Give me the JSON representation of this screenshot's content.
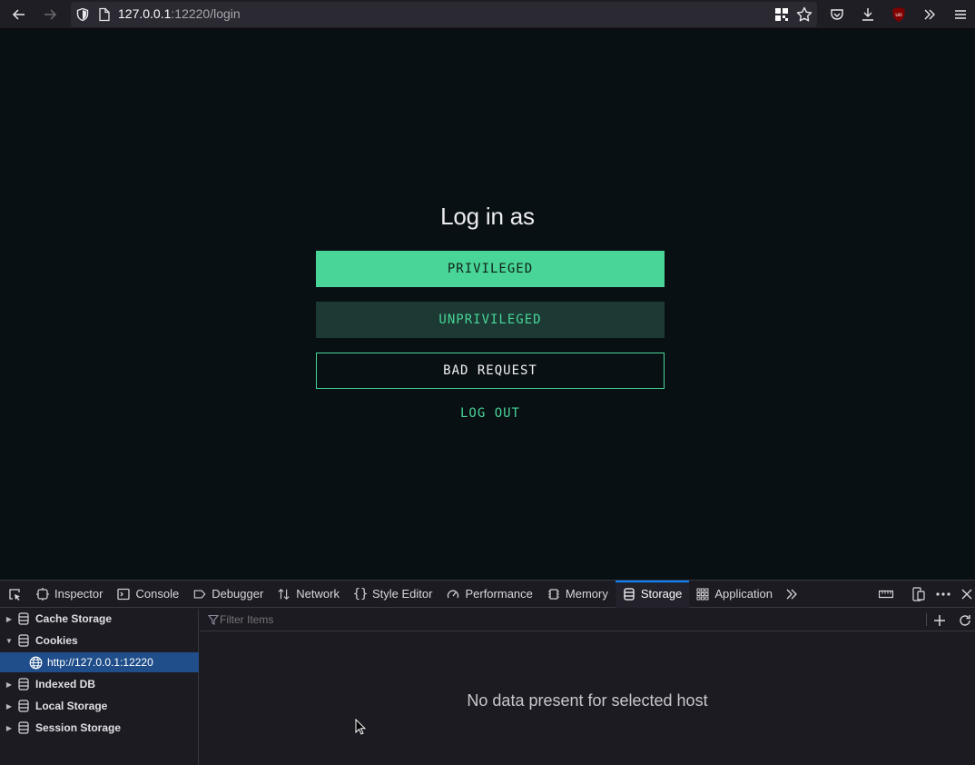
{
  "browser": {
    "url_host": "127.0.0.1",
    "url_rest": ":12220/login"
  },
  "page": {
    "title": "Log in as",
    "buttons": {
      "privileged": "PRIVILEGED",
      "unprivileged": "UNPRIVILEGED",
      "bad_request": "BAD REQUEST",
      "logout": "LOG OUT"
    },
    "colors": {
      "accent": "#48d597",
      "background": "#091014"
    }
  },
  "devtools": {
    "tabs": [
      {
        "label": "Inspector",
        "icon": "inspector-icon"
      },
      {
        "label": "Console",
        "icon": "console-icon"
      },
      {
        "label": "Debugger",
        "icon": "debugger-icon"
      },
      {
        "label": "Network",
        "icon": "network-icon"
      },
      {
        "label": "Style Editor",
        "icon": "style-editor-icon"
      },
      {
        "label": "Performance",
        "icon": "performance-icon"
      },
      {
        "label": "Memory",
        "icon": "memory-icon"
      },
      {
        "label": "Storage",
        "icon": "storage-icon",
        "active": true
      },
      {
        "label": "Application",
        "icon": "application-icon"
      }
    ],
    "sidebar": [
      {
        "label": "Cache Storage",
        "expanded": false
      },
      {
        "label": "Cookies",
        "expanded": true
      },
      {
        "label": "http://127.0.0.1:12220",
        "selected": true
      },
      {
        "label": "Indexed DB",
        "expanded": false
      },
      {
        "label": "Local Storage",
        "expanded": false
      },
      {
        "label": "Session Storage",
        "expanded": false
      }
    ],
    "filter_placeholder": "Filter Items",
    "empty_message": "No data present for selected host"
  }
}
